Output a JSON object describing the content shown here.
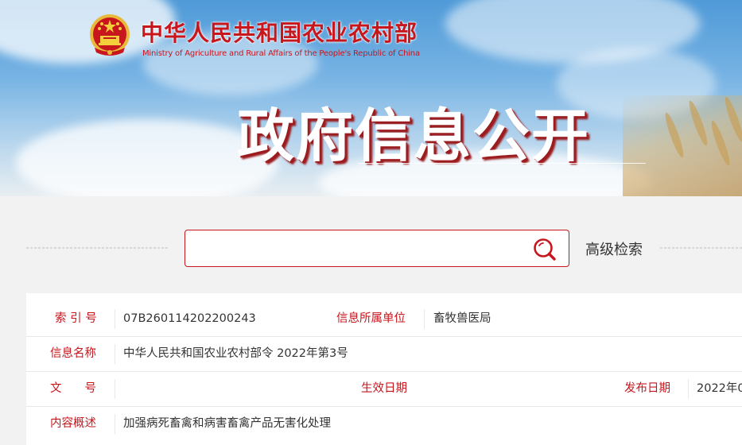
{
  "header": {
    "org_name_cn": "中华人民共和国农业农村部",
    "org_name_en": "Ministry of Agriculture and Rural Affairs of the People's Republic of China",
    "section_title": "政府信息公开",
    "emblem_icon": "national-emblem-icon",
    "brand_color": "#c8161d"
  },
  "search": {
    "value": "",
    "placeholder": "",
    "icon": "search-icon",
    "advanced_label": "高级检索"
  },
  "info": {
    "index_label": "索 引 号",
    "index_value": "07B260114202200243",
    "unit_label": "信息所属单位",
    "unit_value": "畜牧兽医局",
    "name_label": "信息名称",
    "name_value": "中华人民共和国农业农村部令 2022年第3号",
    "doc_no_label": "文　　号",
    "doc_no_value": "",
    "effective_label": "生效日期",
    "effective_value": "",
    "publish_label": "发布日期",
    "publish_value": "2022年0",
    "summary_label": "内容概述",
    "summary_value": "加强病死畜禽和病害畜禽产品无害化处理"
  }
}
